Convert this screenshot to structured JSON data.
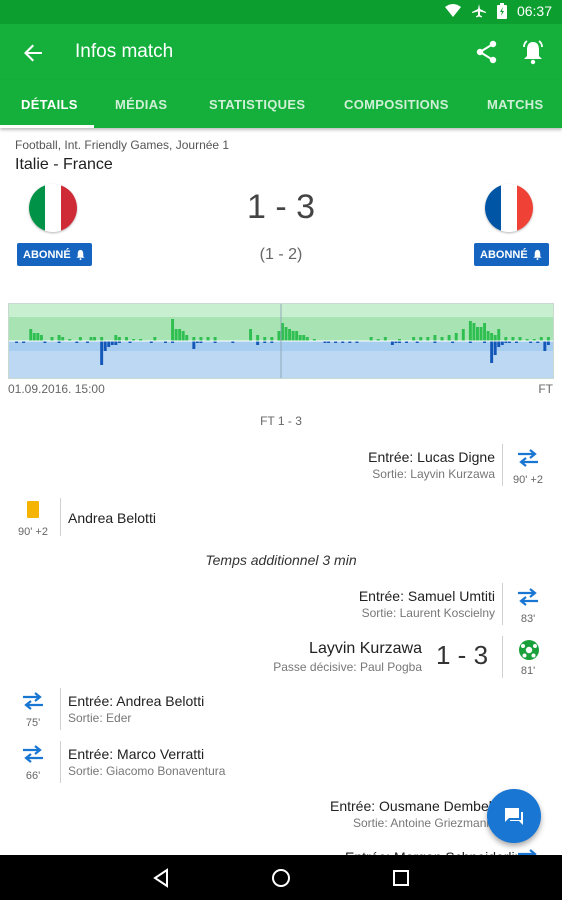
{
  "status_bar": {
    "time": "06:37"
  },
  "app_bar": {
    "title": "Infos match"
  },
  "tabs": [
    {
      "label": "DÉTAILS",
      "active": true
    },
    {
      "label": "MÉDIAS"
    },
    {
      "label": "STATISTIQUES"
    },
    {
      "label": "COMPOSITIONS"
    },
    {
      "label": "MATCHS"
    }
  ],
  "match": {
    "competition": "Football, Int. Friendly Games, Journée 1",
    "teams": "Italie - France",
    "score": "1 - 3",
    "halftime": "(1 - 2)",
    "home_subscribe": "ABONNÉ",
    "away_subscribe": "ABONNÉ",
    "kickoff": "01.09.2016. 15:00",
    "end_label": "FT",
    "final_label": "FT 1 - 3"
  },
  "colors": {
    "green": "#14b03b",
    "blue": "#1565c0",
    "italy": [
      "#009246",
      "#ffffff",
      "#ce2b37"
    ],
    "france": [
      "#0055a4",
      "#ffffff",
      "#ef4135"
    ]
  },
  "events": {
    "e1": {
      "main": "Entrée: Lucas Digne",
      "sub": "Sortie: Layvin Kurzawa",
      "minute": "90' +2",
      "icon": "substitution-icon"
    },
    "e2": {
      "main": "Andrea Belotti",
      "minute": "90' +2",
      "icon": "yellow-card-icon"
    },
    "added_time": "Temps additionnel 3 min",
    "e3": {
      "main": "Entrée: Samuel Umtiti",
      "sub": "Sortie: Laurent Koscielny",
      "minute": "83'",
      "icon": "substitution-icon"
    },
    "e4": {
      "main": "Layvin Kurzawa",
      "sub": "Passe décisive: Paul Pogba",
      "score": "1 - 3",
      "minute": "81'",
      "icon": "goal-icon"
    },
    "e5": {
      "main": "Entrée: Andrea Belotti",
      "sub": "Sortie: Eder",
      "minute": "75'",
      "icon": "substitution-icon"
    },
    "e6": {
      "main": "Entrée: Marco Verratti",
      "sub": "Sortie: Giacomo Bonaventura",
      "minute": "66'",
      "icon": "substitution-icon"
    },
    "e7": {
      "main": "Entrée: Ousmane Dembele",
      "sub": "Sortie: Antoine Griezmann",
      "icon": "substitution-icon"
    },
    "e8": {
      "main": "Entrée: Morgan Schneiderlin",
      "icon": "substitution-icon"
    }
  },
  "momentum": {
    "home": [
      0,
      8,
      12,
      15,
      14,
      10,
      8,
      4,
      4,
      6,
      4,
      4,
      2,
      4,
      6,
      4,
      2,
      2,
      2,
      4,
      4,
      4,
      4,
      4,
      2,
      4,
      4,
      4,
      4,
      3,
      6,
      4,
      4,
      22,
      12,
      12,
      10,
      6,
      4,
      4,
      4,
      4,
      4,
      4,
      4,
      4,
      2,
      2,
      2,
      2,
      12,
      6,
      4,
      4,
      10,
      18,
      14,
      12,
      12,
      10,
      6,
      4,
      2,
      2,
      2,
      2,
      2,
      2,
      2,
      2,
      2,
      2,
      2,
      2,
      2,
      2,
      2,
      2,
      2,
      2,
      2,
      2,
      2,
      2,
      2,
      2,
      2,
      2,
      2,
      2,
      2,
      2,
      4,
      6,
      8,
      6,
      2,
      0,
      0,
      4,
      8,
      14,
      18,
      10,
      8,
      8,
      10,
      8,
      6,
      4,
      4,
      4,
      4,
      4,
      4,
      4,
      4,
      4,
      4,
      4,
      4,
      6,
      22,
      20,
      14,
      14,
      18,
      12,
      10,
      8,
      12,
      6,
      4,
      4,
      4,
      4,
      6,
      4,
      2,
      2,
      4,
      2,
      2,
      6,
      6,
      2,
      2,
      2,
      2,
      4,
      4,
      4,
      4
    ],
    "away": [
      0,
      0,
      0,
      0,
      0,
      0,
      0,
      0,
      0,
      0,
      0,
      0,
      0,
      0,
      0,
      0,
      0,
      0,
      0,
      0,
      0,
      0,
      0,
      0,
      0,
      0,
      0,
      0,
      0,
      0,
      0,
      0,
      0,
      0,
      0,
      0,
      0,
      0,
      0,
      0,
      0,
      0,
      0,
      0,
      0,
      0,
      0,
      0,
      0,
      0,
      0,
      0,
      0,
      0,
      0,
      0,
      0,
      0,
      0,
      0,
      0,
      0,
      0,
      0,
      0,
      0,
      0,
      0,
      0,
      0,
      0,
      0,
      0,
      0,
      0,
      0,
      0,
      0,
      0,
      0,
      0,
      0,
      0,
      0,
      0,
      0,
      0,
      0,
      0,
      0,
      0,
      0,
      0,
      0,
      0,
      0,
      0,
      0,
      0,
      0,
      0,
      0,
      0,
      0,
      0,
      0,
      0,
      0,
      0,
      0,
      0,
      0,
      0,
      0,
      0,
      0,
      0,
      0,
      0,
      0,
      0,
      0,
      0,
      0,
      0,
      0,
      0,
      0,
      0,
      0,
      0,
      0,
      0,
      0,
      0,
      0,
      0,
      0,
      0,
      0,
      0,
      0,
      0,
      0,
      0,
      0,
      0,
      0,
      0,
      0,
      0,
      0,
      0,
      0,
      0
    ]
  }
}
